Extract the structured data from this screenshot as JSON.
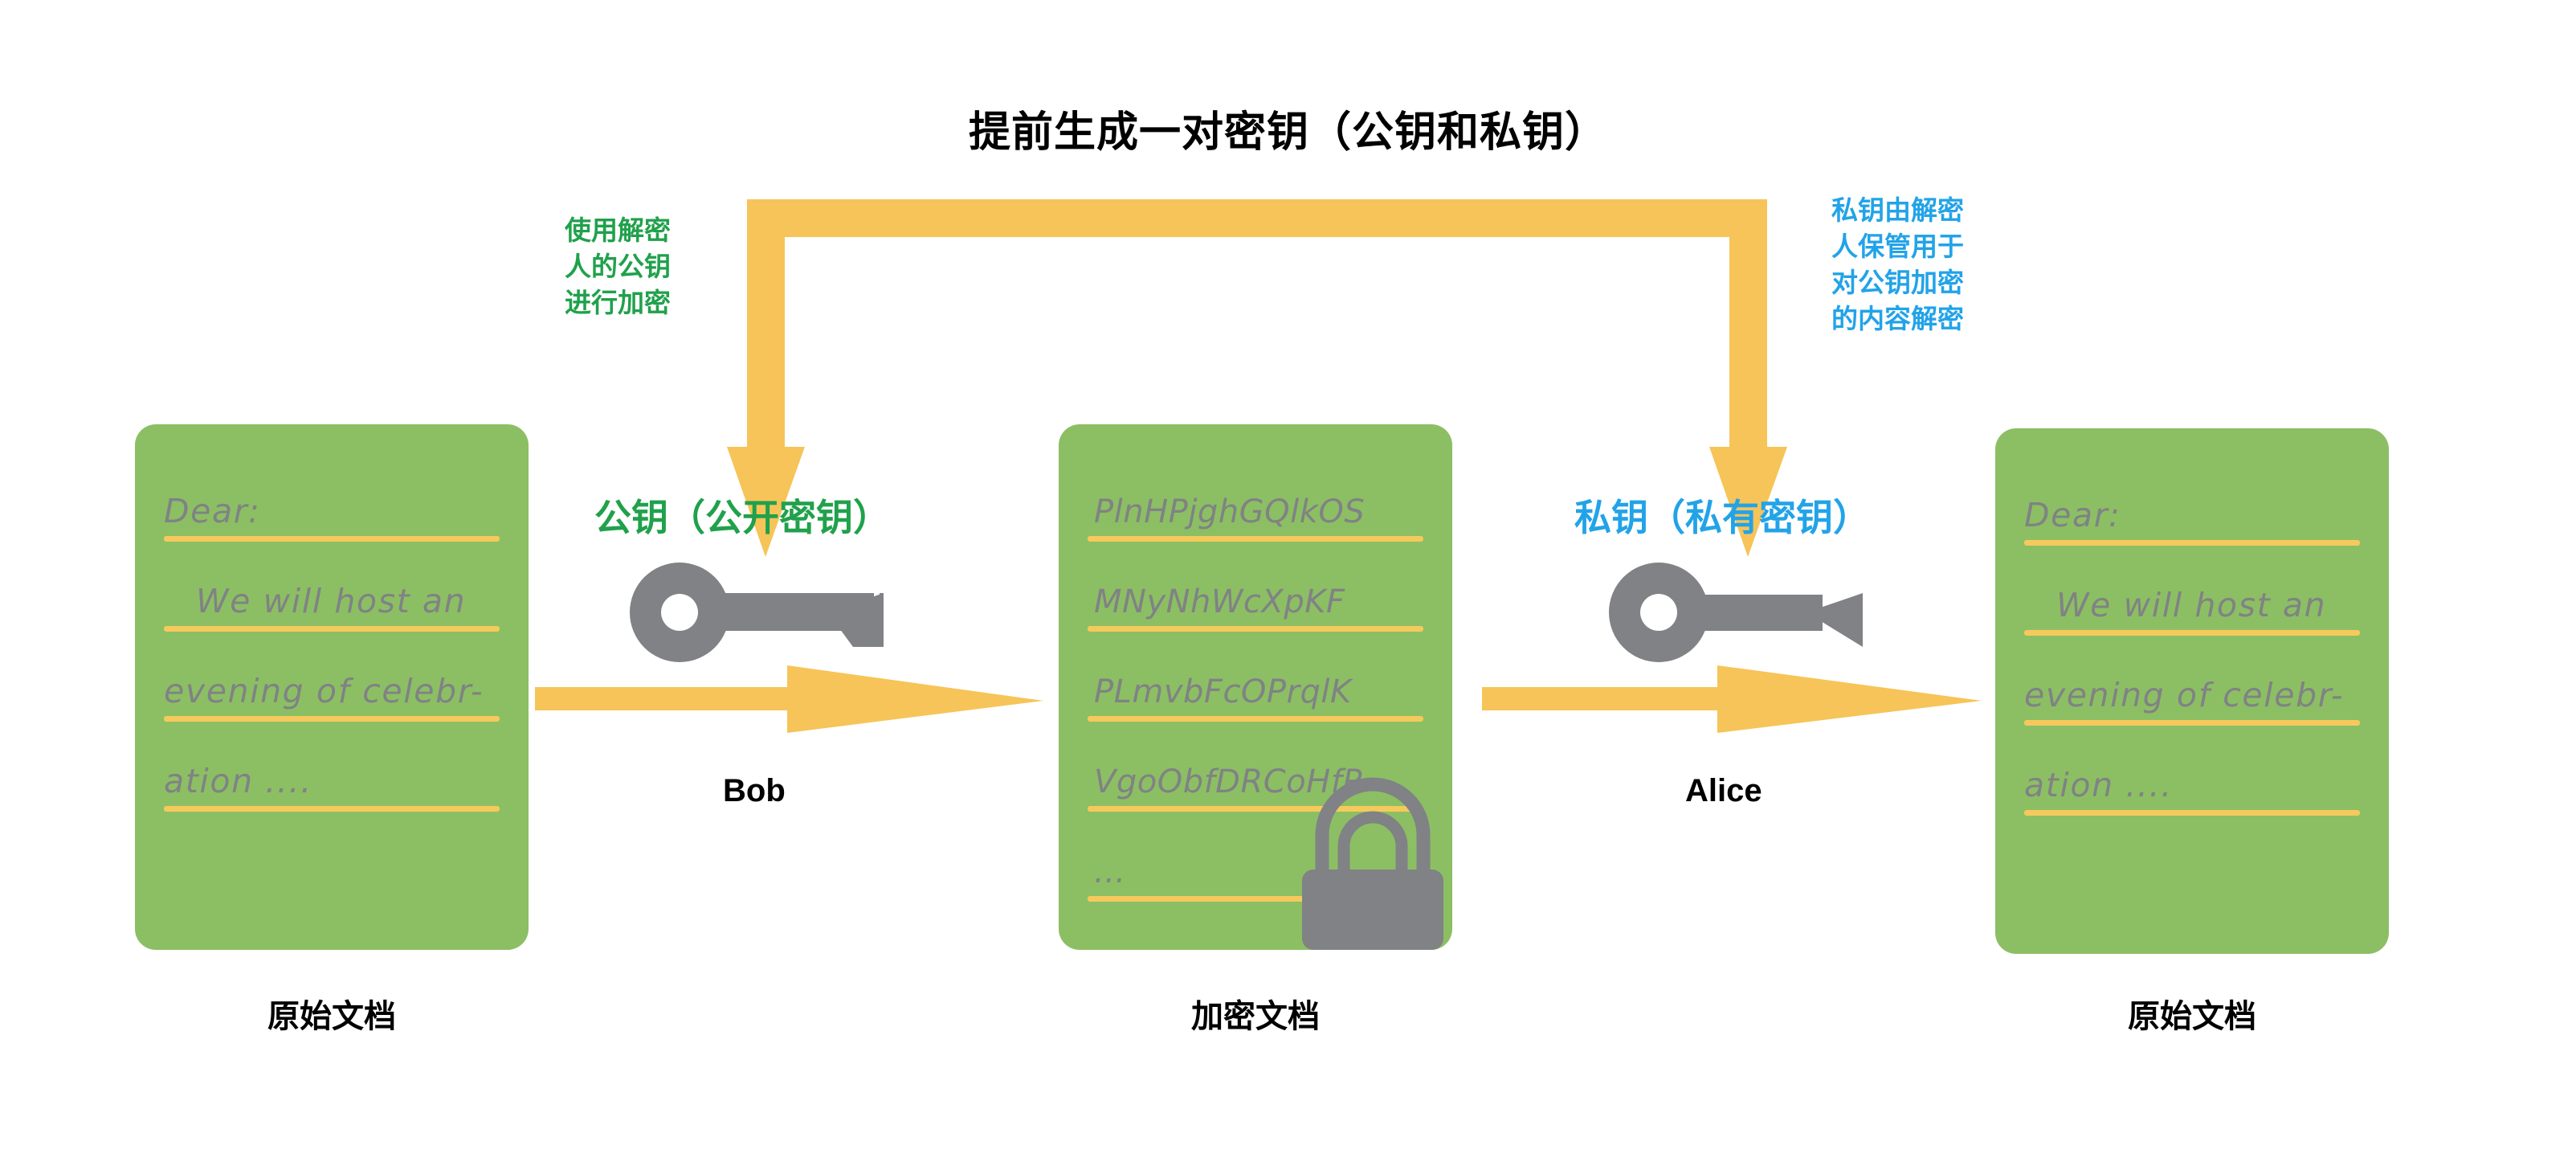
{
  "title": "提前生成一对密钥（公钥和私钥）",
  "colors": {
    "document_green": "#8CBF63",
    "rule_yellow": "#F6C95C",
    "arrow_yellow": "#F6C458",
    "public_green": "#20A14B",
    "private_blue": "#22A3E8",
    "icon_gray": "#808285",
    "text_black": "#000000"
  },
  "notes": {
    "left": {
      "color": "#20A14B",
      "lines": [
        "使用解密",
        "人的公钥",
        "进行加密"
      ]
    },
    "right": {
      "color": "#22A3E8",
      "lines": [
        "私钥由解密",
        "人保管用于",
        "对公钥加密",
        "的内容解密"
      ]
    }
  },
  "documents": {
    "original_left": {
      "caption": "原始文档",
      "lines": [
        "Dear:",
        "We will host an",
        "evening of celebr-",
        "ation ....",
        ""
      ]
    },
    "encrypted": {
      "caption": "加密文档",
      "lines": [
        "PlnHPjghGQlkOS",
        "MNyNhWcXpKF",
        "PLmvbFcOPrqlK",
        "VgoObfDRCoHfR",
        "..."
      ]
    },
    "original_right": {
      "caption": "原始文档",
      "lines": [
        "Dear:",
        "We will host an",
        "evening of celebr-",
        "ation ....",
        ""
      ]
    }
  },
  "keys": {
    "public": {
      "label": "公钥（公开密钥）",
      "icon": "key-icon",
      "color": "#20A14B"
    },
    "private": {
      "label": "私钥（私有密钥）",
      "icon": "key-icon",
      "color": "#22A3E8"
    }
  },
  "people": {
    "encryptor": "Bob",
    "decryptor": "Alice"
  },
  "icons": {
    "lock": "padlock-icon",
    "encrypt_arrow": "arrow-right-icon",
    "decrypt_arrow": "arrow-right-icon",
    "keygen_bracket": "bracket-arrow-icon"
  }
}
